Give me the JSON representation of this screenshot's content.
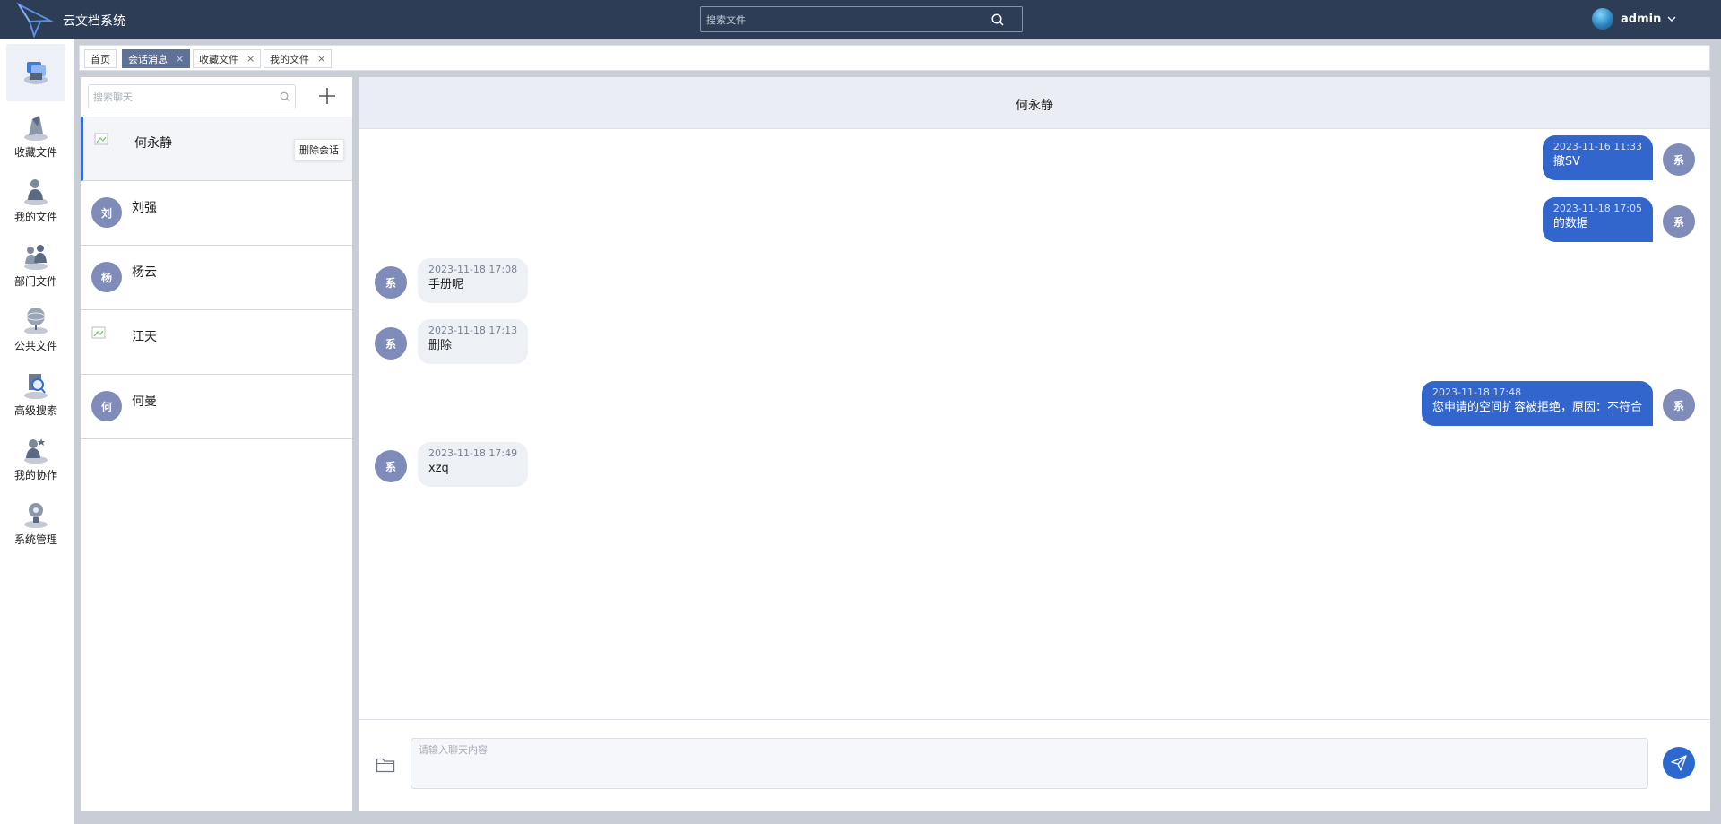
{
  "app": {
    "title": "云文档系统",
    "search_placeholder": "搜索文件",
    "user_name": "admin",
    "brand_color": "#2d3d55",
    "accent_color": "#3366cc"
  },
  "sidebar": {
    "items": [
      {
        "label": "",
        "icon": "message-icon",
        "active": true
      },
      {
        "label": "收藏文件",
        "icon": "favorites-icon"
      },
      {
        "label": "我的文件",
        "icon": "my-files-icon"
      },
      {
        "label": "部门文件",
        "icon": "department-files-icon"
      },
      {
        "label": "公共文件",
        "icon": "public-files-icon"
      },
      {
        "label": "高级搜索",
        "icon": "advanced-search-icon"
      },
      {
        "label": "我的协作",
        "icon": "collaboration-icon"
      },
      {
        "label": "系统管理",
        "icon": "system-admin-icon"
      }
    ]
  },
  "tabs": [
    {
      "label": "首页",
      "closable": false,
      "active": false
    },
    {
      "label": "会话消息",
      "closable": true,
      "active": true
    },
    {
      "label": "收藏文件",
      "closable": true,
      "active": false
    },
    {
      "label": "我的文件",
      "closable": true,
      "active": false
    }
  ],
  "tab_close_glyph": "×",
  "conversations": {
    "search_placeholder": "搜索聊天",
    "delete_tooltip": "删除会话",
    "items": [
      {
        "name": "何永静",
        "avatar_text": "",
        "broken_image": true,
        "active": true
      },
      {
        "name": "刘强",
        "avatar_text": "刘"
      },
      {
        "name": "杨云",
        "avatar_text": "杨"
      },
      {
        "name": "江天",
        "avatar_text": "",
        "broken_image": true
      },
      {
        "name": "何曼",
        "avatar_text": "何"
      }
    ]
  },
  "chat": {
    "title": "何永静",
    "input_placeholder": "请输入聊天内容",
    "messages": [
      {
        "side": "right",
        "avatar": "系",
        "time": "2023-11-16 11:33",
        "text": "撤SV"
      },
      {
        "side": "right",
        "avatar": "系",
        "time": "2023-11-18 17:05",
        "text": "的数据"
      },
      {
        "side": "left",
        "avatar": "系",
        "time": "2023-11-18 17:08",
        "text": "手册呢"
      },
      {
        "side": "left",
        "avatar": "系",
        "time": "2023-11-18 17:13",
        "text": "删除"
      },
      {
        "side": "right",
        "avatar": "系",
        "time": "2023-11-18 17:48",
        "text": "您申请的空间扩容被拒绝，原因：不符合"
      },
      {
        "side": "left",
        "avatar": "系",
        "time": "2023-11-18 17:49",
        "text": "xzq"
      }
    ]
  }
}
